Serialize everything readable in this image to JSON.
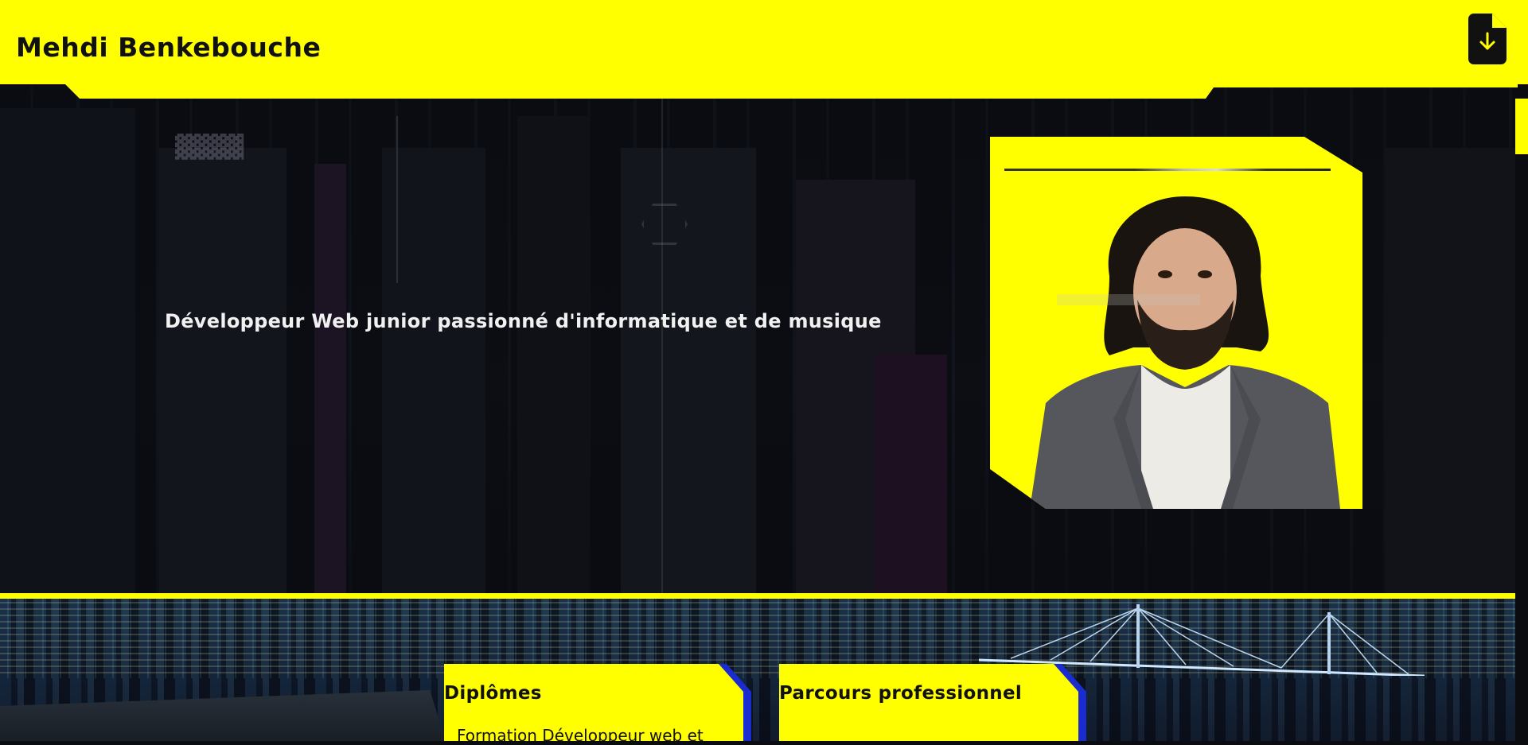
{
  "header": {
    "title": "Mehdi Benkebouche",
    "download_icon": "file-download-icon"
  },
  "hero": {
    "tagline": "Développeur Web junior passionné d'informatique et de musique",
    "portrait_alt": "Portrait de Mehdi Benkebouche"
  },
  "sections": {
    "diplomas": {
      "title": "Diplômes",
      "first_item": "Formation Développeur web et"
    },
    "career": {
      "title": "Parcours professionnel"
    }
  },
  "colors": {
    "accent": "#ffff00",
    "text_dark": "#111111",
    "card_shadow": "#1a2bd0",
    "background": "#0b0c10"
  }
}
